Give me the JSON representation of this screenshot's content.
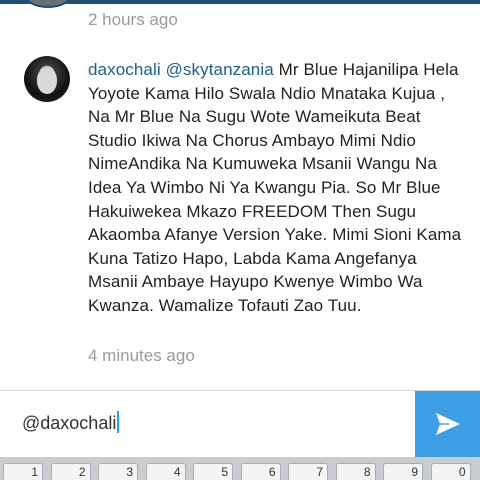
{
  "previous_comment": {
    "time": "2 hours ago"
  },
  "comment": {
    "username": "daxochali",
    "mention": "@skytanzania",
    "text": "Mr Blue Hajanilipa Hela Yoyote Kama Hilo Swala Ndio Mnataka Kujua , Na Mr Blue Na Sugu Wote Wameikuta Beat Studio Ikiwa Na Chorus Ambayo Mimi Ndio NimeAndika Na Kumuweka Msanii Wangu Na Idea Ya Wimbo Ni Ya Kwangu Pia. So Mr Blue Hakuiwekea Mkazo FREEDOM Then Sugu Akaomba Afanye Version Yake. Mimi Sioni Kama Kuna Tatizo Hapo, Labda Kama Angefanya Msanii Ambaye Hayupo Kwenye Wimbo Wa Kwanza. Wamalize Tofauti Zao Tuu.",
    "time": "4 minutes ago"
  },
  "reply_input": {
    "value": "@daxochali"
  },
  "send_button": {
    "icon": "send-arrow-icon"
  },
  "keyboard": {
    "keys": [
      "1",
      "2",
      "3",
      "4",
      "5",
      "6",
      "7",
      "8",
      "9",
      "0"
    ]
  },
  "colors": {
    "username": "#1f5d8a",
    "timestamp": "#9a9a9a",
    "send_button": "#3f9fe6"
  }
}
